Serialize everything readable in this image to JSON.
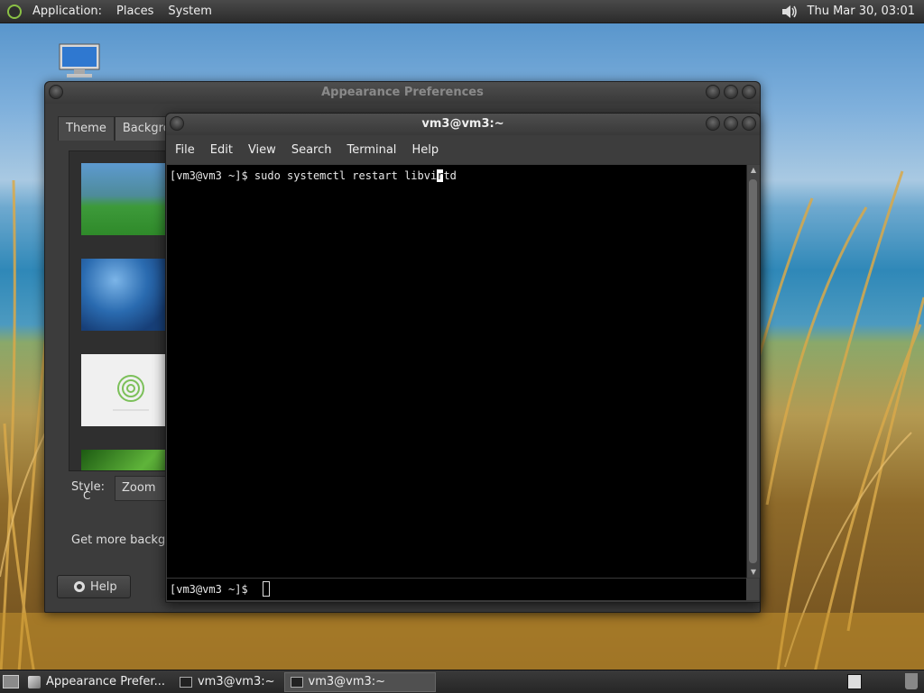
{
  "top_panel": {
    "menus": [
      "Application:",
      "Places",
      "System"
    ],
    "clock": "Thu Mar 30, 03:01",
    "icons": {
      "logo": "distro-logo-icon",
      "volume": "speaker-icon"
    }
  },
  "desktop": {
    "icons": [
      {
        "name": "computer-icon"
      }
    ]
  },
  "appearance_window": {
    "title": "Appearance Preferences",
    "tabs": [
      "Theme",
      "Backgrou"
    ],
    "style_label": "Style:",
    "style_value": "Zoom",
    "get_more_text": "Get more backgro",
    "help_label": "Help",
    "stray_text": "C"
  },
  "terminal_window": {
    "title": "vm3@vm3:~",
    "menu": [
      "File",
      "Edit",
      "View",
      "Search",
      "Terminal",
      "Help"
    ],
    "line_before_cursor": "[vm3@vm3 ~]$ sudo systemctl restart libvi",
    "cursor_char": "r",
    "line_after_cursor": "td",
    "prompt": "[vm3@vm3 ~]$"
  },
  "bottom_panel": {
    "tasks": [
      {
        "label": "Appearance Prefer...",
        "icon": "appearance-icon",
        "active": false
      },
      {
        "label": "vm3@vm3:~",
        "icon": "terminal-icon",
        "active": false
      },
      {
        "label": "vm3@vm3:~",
        "icon": "terminal-icon",
        "active": true
      }
    ]
  },
  "colors": {
    "accent_green": "#8ac045",
    "terminal_bg": "#000000",
    "panel_bg": "#2b2b2b"
  }
}
